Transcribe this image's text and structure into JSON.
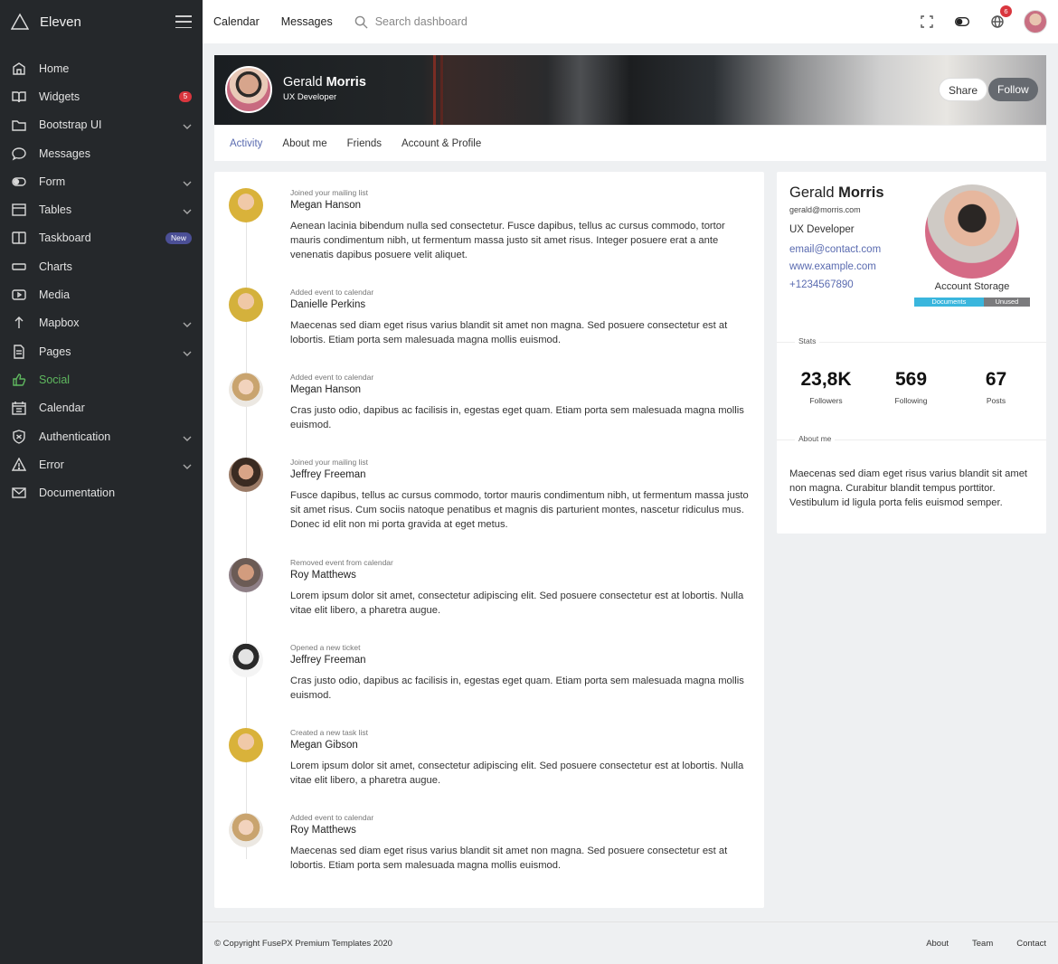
{
  "brand": {
    "name": "Eleven"
  },
  "sidebar": {
    "items": [
      {
        "label": "Home",
        "icon": "home-icon"
      },
      {
        "label": "Widgets",
        "icon": "book-icon",
        "badge": "5"
      },
      {
        "label": "Bootstrap UI",
        "icon": "folder-icon",
        "expandable": true
      },
      {
        "label": "Messages",
        "icon": "chat-icon"
      },
      {
        "label": "Form",
        "icon": "toggle-icon",
        "expandable": true
      },
      {
        "label": "Tables",
        "icon": "table-icon",
        "expandable": true
      },
      {
        "label": "Taskboard",
        "icon": "board-icon",
        "badge": "New"
      },
      {
        "label": "Charts",
        "icon": "chart-icon"
      },
      {
        "label": "Media",
        "icon": "play-icon"
      },
      {
        "label": "Mapbox",
        "icon": "arrow-up-icon",
        "expandable": true
      },
      {
        "label": "Pages",
        "icon": "page-icon",
        "expandable": true
      },
      {
        "label": "Social",
        "icon": "thumb-up-icon",
        "active": true
      },
      {
        "label": "Calendar",
        "icon": "calendar-icon"
      },
      {
        "label": "Authentication",
        "icon": "shield-icon",
        "expandable": true
      },
      {
        "label": "Error",
        "icon": "warning-icon",
        "expandable": true
      },
      {
        "label": "Documentation",
        "icon": "mail-icon"
      }
    ]
  },
  "topbar": {
    "links": [
      "Calendar",
      "Messages"
    ],
    "search_placeholder": "Search dashboard",
    "notification_count": "6"
  },
  "profile": {
    "first_name": "Gerald",
    "last_name": "Morris",
    "role": "UX Developer",
    "share_label": "Share",
    "follow_label": "Follow",
    "tabs": [
      "Activity",
      "About me",
      "Friends",
      "Account & Profile"
    ],
    "active_tab": "Activity"
  },
  "activity": [
    {
      "meta": "Joined your mailing list",
      "name": "Megan Hanson",
      "text": "Aenean lacinia bibendum nulla sed consectetur. Fusce dapibus, tellus ac cursus commodo, tortor mauris condimentum nibh, ut fermentum massa justo sit amet risus. Integer posuere erat a ante venenatis dapibus posuere velit aliquet."
    },
    {
      "meta": "Added event to calendar",
      "name": "Danielle Perkins",
      "text": "Maecenas sed diam eget risus varius blandit sit amet non magna. Sed posuere consectetur est at lobortis. Etiam porta sem malesuada magna mollis euismod."
    },
    {
      "meta": "Added event to calendar",
      "name": "Megan Hanson",
      "text": "Cras justo odio, dapibus ac facilisis in, egestas eget quam. Etiam porta sem malesuada magna mollis euismod."
    },
    {
      "meta": "Joined your mailing list",
      "name": "Jeffrey Freeman",
      "text": "Fusce dapibus, tellus ac cursus commodo, tortor mauris condimentum nibh, ut fermentum massa justo sit amet risus. Cum sociis natoque penatibus et magnis dis parturient montes, nascetur ridiculus mus. Donec id elit non mi porta gravida at eget metus."
    },
    {
      "meta": "Removed event from calendar",
      "name": "Roy Matthews",
      "text": "Lorem ipsum dolor sit amet, consectetur adipiscing elit. Sed posuere consectetur est at lobortis. Nulla vitae elit libero, a pharetra augue."
    },
    {
      "meta": "Opened a new ticket",
      "name": "Jeffrey Freeman",
      "text": "Cras justo odio, dapibus ac facilisis in, egestas eget quam. Etiam porta sem malesuada magna mollis euismod."
    },
    {
      "meta": "Created a new task list",
      "name": "Megan Gibson",
      "text": "Lorem ipsum dolor sit amet, consectetur adipiscing elit. Sed posuere consectetur est at lobortis. Nulla vitae elit libero, a pharetra augue."
    },
    {
      "meta": "Added event to calendar",
      "name": "Roy Matthews",
      "text": "Maecenas sed diam eget risus varius blandit sit amet non magna. Sed posuere consectetur est at lobortis. Etiam porta sem malesuada magna mollis euismod."
    }
  ],
  "about_card": {
    "first_name": "Gerald",
    "last_name": "Morris",
    "email": "gerald@morris.com",
    "role": "UX Developer",
    "contact_email": "email@contact.com",
    "website": "www.example.com",
    "phone": "+1234567890",
    "storage_label": "Account Storage",
    "storage_documents_label": "Documents",
    "storage_unused_label": "Unused",
    "storage_documents_fraction": 0.6,
    "stats_title": "Stats",
    "stats": [
      {
        "value": "23,8K",
        "label": "Followers"
      },
      {
        "value": "569",
        "label": "Following"
      },
      {
        "value": "67",
        "label": "Posts"
      }
    ],
    "about_title": "About me",
    "about_text": "Maecenas sed diam eget risus varius blandit sit amet non magna. Curabitur blandit tempus porttitor. Vestibulum id ligula porta felis euismod semper."
  },
  "footer": {
    "copyright": "© Copyright FusePX Premium Templates 2020",
    "links": [
      "About",
      "Team",
      "Contact"
    ]
  },
  "colors": {
    "sidebar_bg": "#25282b",
    "active_green": "#5fb85f",
    "link_purple": "#5a6bb0",
    "badge_red": "#d9363e",
    "storage_blue": "#3ab6dd"
  }
}
